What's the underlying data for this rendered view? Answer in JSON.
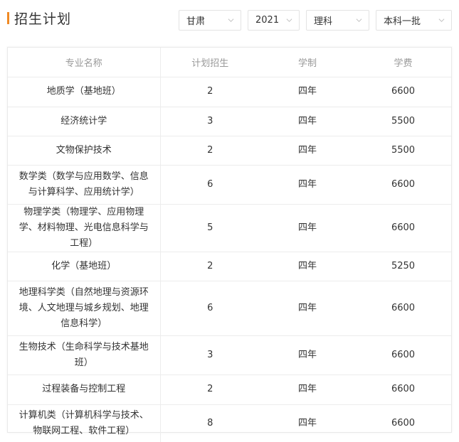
{
  "header": {
    "title": "招生计划",
    "filters": {
      "province": "甘肃",
      "year": "2021",
      "subject": "理科",
      "batch": "本科一批"
    }
  },
  "colors": {
    "accent": "#f08a24"
  },
  "table": {
    "columns": [
      "专业名称",
      "计划招生",
      "学制",
      "学费"
    ],
    "rows": [
      {
        "name": "地质学（基地班）",
        "plan": "2",
        "years": "四年",
        "fee": "6600"
      },
      {
        "name": "经济统计学",
        "plan": "3",
        "years": "四年",
        "fee": "5500"
      },
      {
        "name": "文物保护技术",
        "plan": "2",
        "years": "四年",
        "fee": "5500"
      },
      {
        "name": "数学类（数学与应用数学、信息与计算科学、应用统计学）",
        "plan": "6",
        "years": "四年",
        "fee": "6600"
      },
      {
        "name": "物理学类（物理学、应用物理学、材料物理、光电信息科学与工程）",
        "plan": "5",
        "years": "四年",
        "fee": "6600"
      },
      {
        "name": "化学（基地班）",
        "plan": "2",
        "years": "四年",
        "fee": "5250"
      },
      {
        "name": "地理科学类（自然地理与资源环境、人文地理与城乡规划、地理信息科学）",
        "plan": "6",
        "years": "四年",
        "fee": "6600"
      },
      {
        "name": "生物技术（生命科学与技术基地班）",
        "plan": "3",
        "years": "四年",
        "fee": "6600"
      },
      {
        "name": "过程装备与控制工程",
        "plan": "2",
        "years": "四年",
        "fee": "6600"
      },
      {
        "name": "计算机类（计算机科学与技术、物联网工程、软件工程）",
        "plan": "8",
        "years": "四年",
        "fee": "6600"
      }
    ]
  }
}
